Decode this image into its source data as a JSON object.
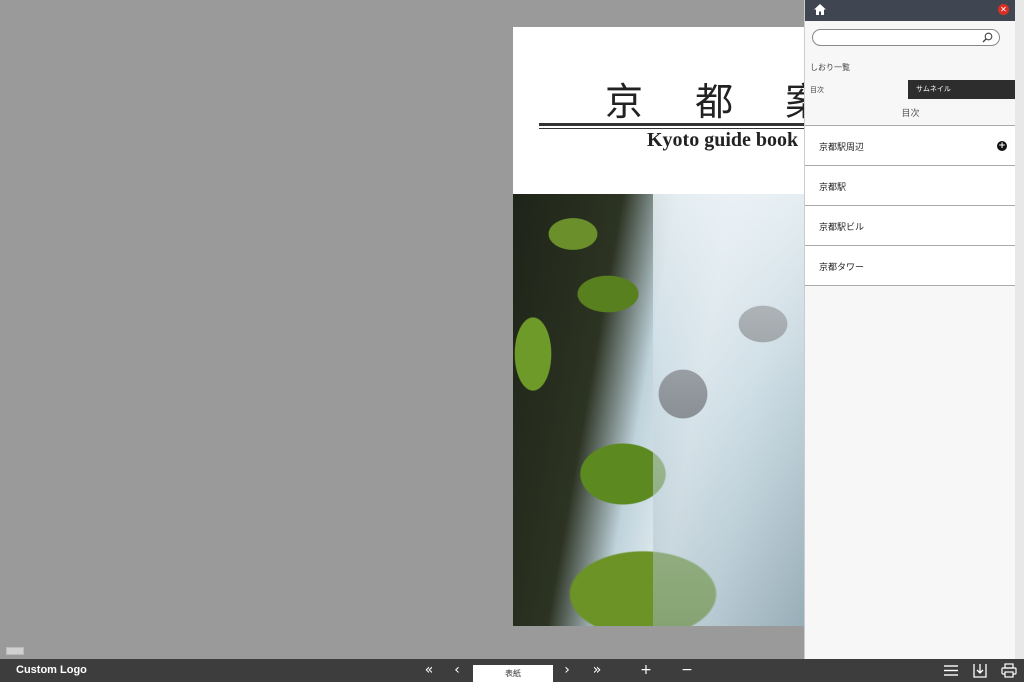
{
  "book": {
    "title": "京 都 案",
    "subtitle": "Kyoto guide book"
  },
  "panel": {
    "search": {
      "placeholder": "",
      "value": ""
    },
    "bookmarks_label": "しおり一覧",
    "tabs": {
      "toc": "目次",
      "thumbnails": "サムネイル"
    },
    "toc_heading": "目次",
    "toc_items": [
      {
        "label": "京都駅周辺",
        "expandable": true
      },
      {
        "label": "京都駅",
        "expandable": false
      },
      {
        "label": "京都駅ビル",
        "expandable": false
      },
      {
        "label": "京都タワー",
        "expandable": false
      }
    ]
  },
  "toolbar": {
    "logo": "Custom Logo",
    "first_page": "«",
    "prev_page": "‹",
    "current_page": "表紙",
    "next_page": "›",
    "last_page": "»",
    "zoom_in": "+",
    "zoom_out": "−"
  },
  "icons": [
    "home-icon",
    "close-icon",
    "search-icon",
    "plus-icon",
    "menu-icon",
    "download-icon",
    "print-icon"
  ],
  "colors": {
    "panel_topbar": "#3f4651",
    "toolbar": "#3d3d3d",
    "background": "#9a9a9a",
    "close": "#d93025"
  }
}
